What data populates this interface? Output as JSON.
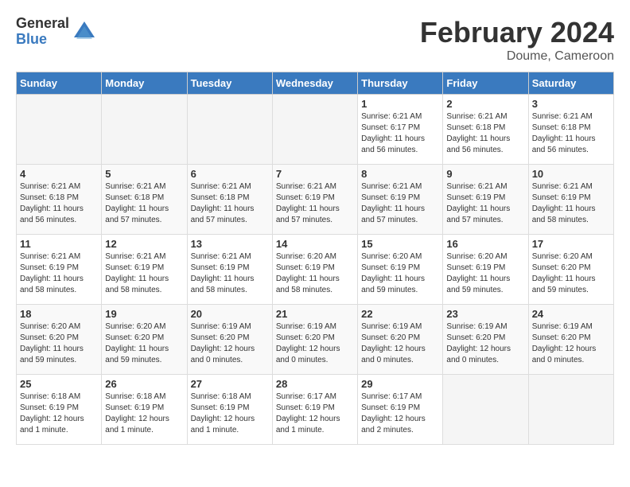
{
  "logo": {
    "general": "General",
    "blue": "Blue"
  },
  "title": "February 2024",
  "subtitle": "Doume, Cameroon",
  "days_of_week": [
    "Sunday",
    "Monday",
    "Tuesday",
    "Wednesday",
    "Thursday",
    "Friday",
    "Saturday"
  ],
  "weeks": [
    [
      {
        "day": "",
        "info": ""
      },
      {
        "day": "",
        "info": ""
      },
      {
        "day": "",
        "info": ""
      },
      {
        "day": "",
        "info": ""
      },
      {
        "day": "1",
        "info": "Sunrise: 6:21 AM\nSunset: 6:17 PM\nDaylight: 11 hours\nand 56 minutes."
      },
      {
        "day": "2",
        "info": "Sunrise: 6:21 AM\nSunset: 6:18 PM\nDaylight: 11 hours\nand 56 minutes."
      },
      {
        "day": "3",
        "info": "Sunrise: 6:21 AM\nSunset: 6:18 PM\nDaylight: 11 hours\nand 56 minutes."
      }
    ],
    [
      {
        "day": "4",
        "info": "Sunrise: 6:21 AM\nSunset: 6:18 PM\nDaylight: 11 hours\nand 56 minutes."
      },
      {
        "day": "5",
        "info": "Sunrise: 6:21 AM\nSunset: 6:18 PM\nDaylight: 11 hours\nand 57 minutes."
      },
      {
        "day": "6",
        "info": "Sunrise: 6:21 AM\nSunset: 6:18 PM\nDaylight: 11 hours\nand 57 minutes."
      },
      {
        "day": "7",
        "info": "Sunrise: 6:21 AM\nSunset: 6:19 PM\nDaylight: 11 hours\nand 57 minutes."
      },
      {
        "day": "8",
        "info": "Sunrise: 6:21 AM\nSunset: 6:19 PM\nDaylight: 11 hours\nand 57 minutes."
      },
      {
        "day": "9",
        "info": "Sunrise: 6:21 AM\nSunset: 6:19 PM\nDaylight: 11 hours\nand 57 minutes."
      },
      {
        "day": "10",
        "info": "Sunrise: 6:21 AM\nSunset: 6:19 PM\nDaylight: 11 hours\nand 58 minutes."
      }
    ],
    [
      {
        "day": "11",
        "info": "Sunrise: 6:21 AM\nSunset: 6:19 PM\nDaylight: 11 hours\nand 58 minutes."
      },
      {
        "day": "12",
        "info": "Sunrise: 6:21 AM\nSunset: 6:19 PM\nDaylight: 11 hours\nand 58 minutes."
      },
      {
        "day": "13",
        "info": "Sunrise: 6:21 AM\nSunset: 6:19 PM\nDaylight: 11 hours\nand 58 minutes."
      },
      {
        "day": "14",
        "info": "Sunrise: 6:20 AM\nSunset: 6:19 PM\nDaylight: 11 hours\nand 58 minutes."
      },
      {
        "day": "15",
        "info": "Sunrise: 6:20 AM\nSunset: 6:19 PM\nDaylight: 11 hours\nand 59 minutes."
      },
      {
        "day": "16",
        "info": "Sunrise: 6:20 AM\nSunset: 6:19 PM\nDaylight: 11 hours\nand 59 minutes."
      },
      {
        "day": "17",
        "info": "Sunrise: 6:20 AM\nSunset: 6:20 PM\nDaylight: 11 hours\nand 59 minutes."
      }
    ],
    [
      {
        "day": "18",
        "info": "Sunrise: 6:20 AM\nSunset: 6:20 PM\nDaylight: 11 hours\nand 59 minutes."
      },
      {
        "day": "19",
        "info": "Sunrise: 6:20 AM\nSunset: 6:20 PM\nDaylight: 11 hours\nand 59 minutes."
      },
      {
        "day": "20",
        "info": "Sunrise: 6:19 AM\nSunset: 6:20 PM\nDaylight: 12 hours\nand 0 minutes."
      },
      {
        "day": "21",
        "info": "Sunrise: 6:19 AM\nSunset: 6:20 PM\nDaylight: 12 hours\nand 0 minutes."
      },
      {
        "day": "22",
        "info": "Sunrise: 6:19 AM\nSunset: 6:20 PM\nDaylight: 12 hours\nand 0 minutes."
      },
      {
        "day": "23",
        "info": "Sunrise: 6:19 AM\nSunset: 6:20 PM\nDaylight: 12 hours\nand 0 minutes."
      },
      {
        "day": "24",
        "info": "Sunrise: 6:19 AM\nSunset: 6:20 PM\nDaylight: 12 hours\nand 0 minutes."
      }
    ],
    [
      {
        "day": "25",
        "info": "Sunrise: 6:18 AM\nSunset: 6:19 PM\nDaylight: 12 hours\nand 1 minute."
      },
      {
        "day": "26",
        "info": "Sunrise: 6:18 AM\nSunset: 6:19 PM\nDaylight: 12 hours\nand 1 minute."
      },
      {
        "day": "27",
        "info": "Sunrise: 6:18 AM\nSunset: 6:19 PM\nDaylight: 12 hours\nand 1 minute."
      },
      {
        "day": "28",
        "info": "Sunrise: 6:17 AM\nSunset: 6:19 PM\nDaylight: 12 hours\nand 1 minute."
      },
      {
        "day": "29",
        "info": "Sunrise: 6:17 AM\nSunset: 6:19 PM\nDaylight: 12 hours\nand 2 minutes."
      },
      {
        "day": "",
        "info": ""
      },
      {
        "day": "",
        "info": ""
      }
    ]
  ]
}
